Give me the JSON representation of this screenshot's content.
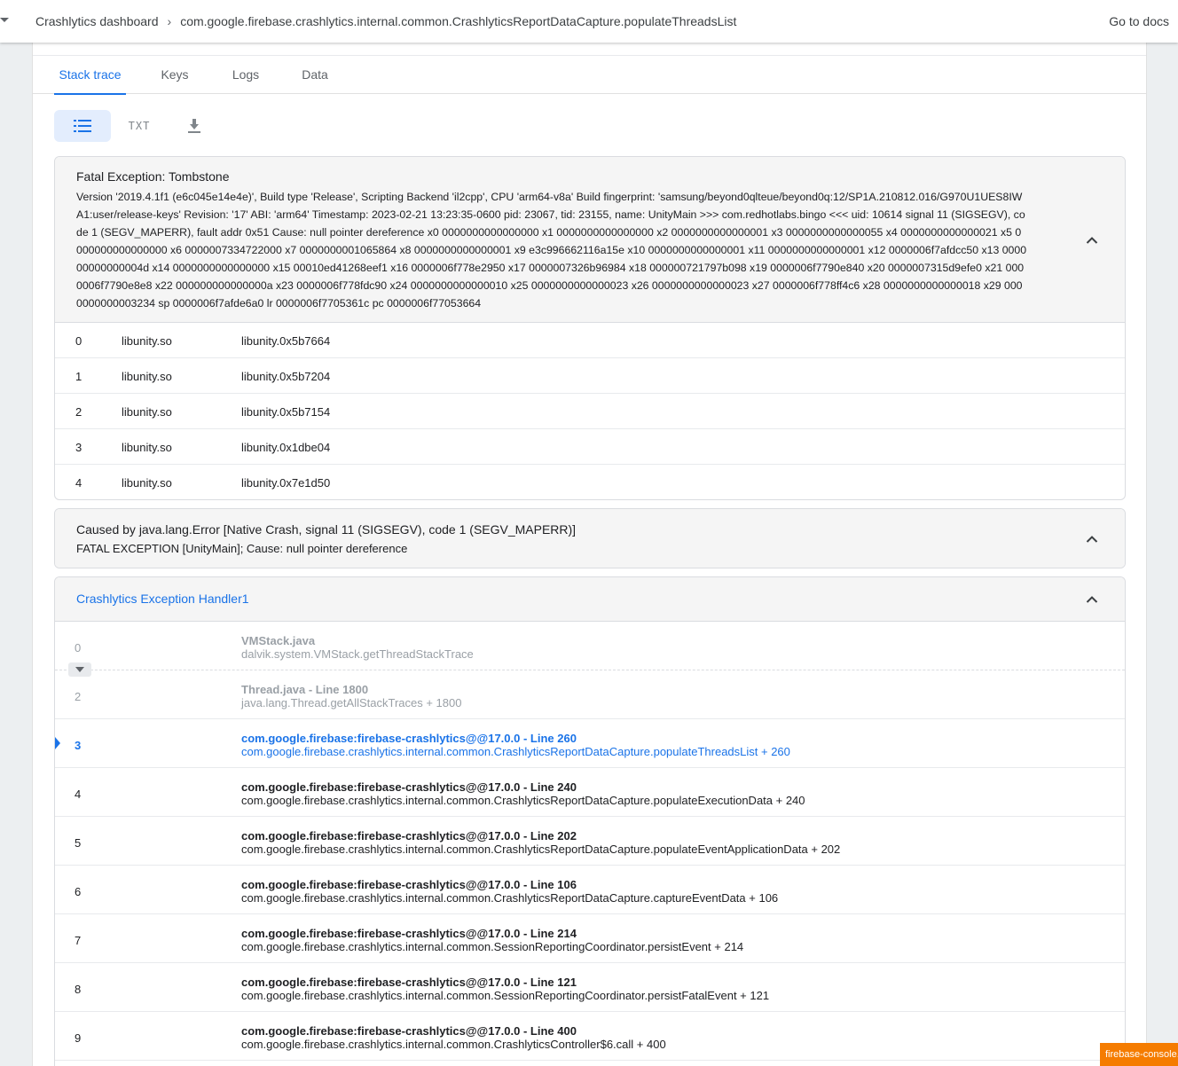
{
  "header": {
    "breadcrumb": [
      "Crashlytics dashboard",
      "com.google.firebase.crashlytics.internal.common.CrashlyticsReportDataCapture.populateThreadsList"
    ],
    "breadcrumb_separator": "›",
    "docs_link": "Go to docs"
  },
  "tabs": [
    {
      "label": "Stack trace",
      "active": true
    },
    {
      "label": "Keys",
      "active": false
    },
    {
      "label": "Logs",
      "active": false
    },
    {
      "label": "Data",
      "active": false
    }
  ],
  "view_toggles": {
    "list_icon": "list-icon",
    "txt_label": "TXT",
    "download_icon": "download-icon"
  },
  "fatal_exception": {
    "title": "Fatal Exception: Tombstone",
    "detail": "Version '2019.4.1f1 (e6c045e14e4e)', Build type 'Release', Scripting Backend 'il2cpp', CPU 'arm64-v8a' Build fingerprint: 'samsung/beyond0qlteue/beyond0q:12/SP1A.210812.016/G970U1UES8IWA1:user/release-keys' Revision: '17' ABI: 'arm64' Timestamp: 2023-02-21 13:23:35-0600 pid: 23067, tid: 23155, name: UnityMain >>> com.redhotlabs.bingo <<< uid: 10614 signal 11 (SIGSEGV), code 1 (SEGV_MAPERR), fault addr 0x51 Cause: null pointer dereference x0 0000000000000000 x1 0000000000000000 x2 0000000000000001 x3 0000000000000055 x4 0000000000000021 x5 0000000000000000 x6 0000007334722000 x7 0000000001065864 x8 0000000000000001 x9 e3c996662116a15e x10 0000000000000001 x11 0000000000000001 x12 0000006f7afdcc50 x13 000000000000004d x14 0000000000000000 x15 00010ed41268eef1 x16 0000006f778e2950 x17 0000007326b96984 x18 000000721797b098 x19 0000006f7790e840 x20 0000007315d9efe0 x21 0000006f7790e8e8 x22 000000000000000a x23 0000006f778fdc90 x24 0000000000000010 x25 0000000000000023 x26 0000000000000023 x27 0000006f778ff4c6 x28 0000000000000018 x29 0000000000003234 sp 0000006f7afde6a0 lr 0000006f7705361c pc 0000006f77053664",
    "frames": [
      {
        "index": "0",
        "library": "libunity.so",
        "symbol": "libunity.0x5b7664"
      },
      {
        "index": "1",
        "library": "libunity.so",
        "symbol": "libunity.0x5b7204"
      },
      {
        "index": "2",
        "library": "libunity.so",
        "symbol": "libunity.0x5b7154"
      },
      {
        "index": "3",
        "library": "libunity.so",
        "symbol": "libunity.0x1dbe04"
      },
      {
        "index": "4",
        "library": "libunity.so",
        "symbol": "libunity.0x7e1d50"
      }
    ]
  },
  "caused_by": {
    "title": "Caused by java.lang.Error [Native Crash, signal 11 (SIGSEGV), code 1 (SEGV_MAPERR)]",
    "subtitle": "FATAL EXCEPTION [UnityMain]; Cause: null pointer dereference"
  },
  "thread": {
    "name": "Crashlytics Exception Handler1",
    "frames": [
      {
        "index": "0",
        "file": "VMStack.java",
        "method": "dalvik.system.VMStack.getThreadStackTrace",
        "style": "dim"
      },
      {
        "index": "2",
        "file": "Thread.java - Line 1800",
        "method": "java.lang.Thread.getAllStackTraces + 1800",
        "style": "dim"
      },
      {
        "index": "3",
        "file": "com.google.firebase:firebase-crashlytics@@17.0.0 - Line 260",
        "method": "com.google.firebase.crashlytics.internal.common.CrashlyticsReportDataCapture.populateThreadsList + 260",
        "style": "active"
      },
      {
        "index": "4",
        "file": "com.google.firebase:firebase-crashlytics@@17.0.0 - Line 240",
        "method": "com.google.firebase.crashlytics.internal.common.CrashlyticsReportDataCapture.populateExecutionData + 240",
        "style": "normal"
      },
      {
        "index": "5",
        "file": "com.google.firebase:firebase-crashlytics@@17.0.0 - Line 202",
        "method": "com.google.firebase.crashlytics.internal.common.CrashlyticsReportDataCapture.populateEventApplicationData + 202",
        "style": "normal"
      },
      {
        "index": "6",
        "file": "com.google.firebase:firebase-crashlytics@@17.0.0 - Line 106",
        "method": "com.google.firebase.crashlytics.internal.common.CrashlyticsReportDataCapture.captureEventData + 106",
        "style": "normal"
      },
      {
        "index": "7",
        "file": "com.google.firebase:firebase-crashlytics@@17.0.0 - Line 214",
        "method": "com.google.firebase.crashlytics.internal.common.SessionReportingCoordinator.persistEvent + 214",
        "style": "normal"
      },
      {
        "index": "8",
        "file": "com.google.firebase:firebase-crashlytics@@17.0.0 - Line 121",
        "method": "com.google.firebase.crashlytics.internal.common.SessionReportingCoordinator.persistFatalEvent + 121",
        "style": "normal"
      },
      {
        "index": "9",
        "file": "com.google.firebase:firebase-crashlytics@@17.0.0 - Line 400",
        "method": "com.google.firebase.crashlytics.internal.common.CrashlyticsController$6.call + 400",
        "style": "normal"
      }
    ]
  },
  "footer_badge": "firebase-console.u",
  "colors": {
    "accent": "#1a73e8",
    "badge": "#f57c00",
    "page_background": "#eceff1"
  }
}
